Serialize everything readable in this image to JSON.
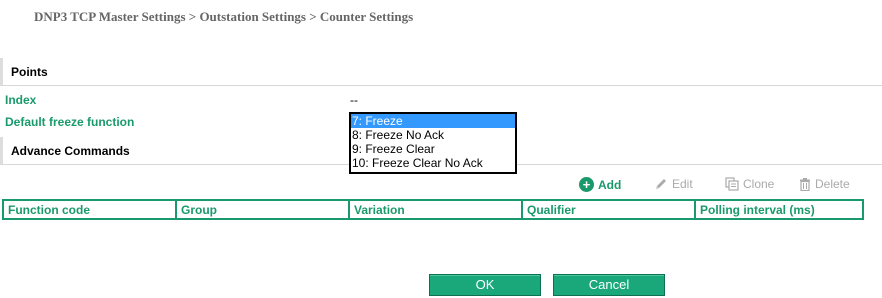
{
  "breadcrumb": "DNP3 TCP Master Settings > Outstation Settings > Counter Settings",
  "points": {
    "title": "Points",
    "index_label": "Index",
    "index_value": "--",
    "freeze_label": "Default freeze function",
    "freeze_options": [
      "7: Freeze",
      "8: Freeze No Ack",
      "9: Freeze Clear",
      "10: Freeze Clear No Ack"
    ],
    "freeze_selected": "7: Freeze"
  },
  "advance": {
    "title": "Advance Commands"
  },
  "toolbar": {
    "add": "Add",
    "edit": "Edit",
    "clone": "Clone",
    "delete": "Delete"
  },
  "table": {
    "headers": [
      "Function code",
      "Group",
      "Variation",
      "Qualifier",
      "Polling interval (ms)"
    ]
  },
  "buttons": {
    "ok": "OK",
    "cancel": "Cancel"
  },
  "colors": {
    "accent": "#1a9a6c",
    "selection": "#3399ff",
    "disabled": "#aaaaaa"
  },
  "icons": [
    "add-icon",
    "edit-icon",
    "clone-icon",
    "delete-icon"
  ]
}
